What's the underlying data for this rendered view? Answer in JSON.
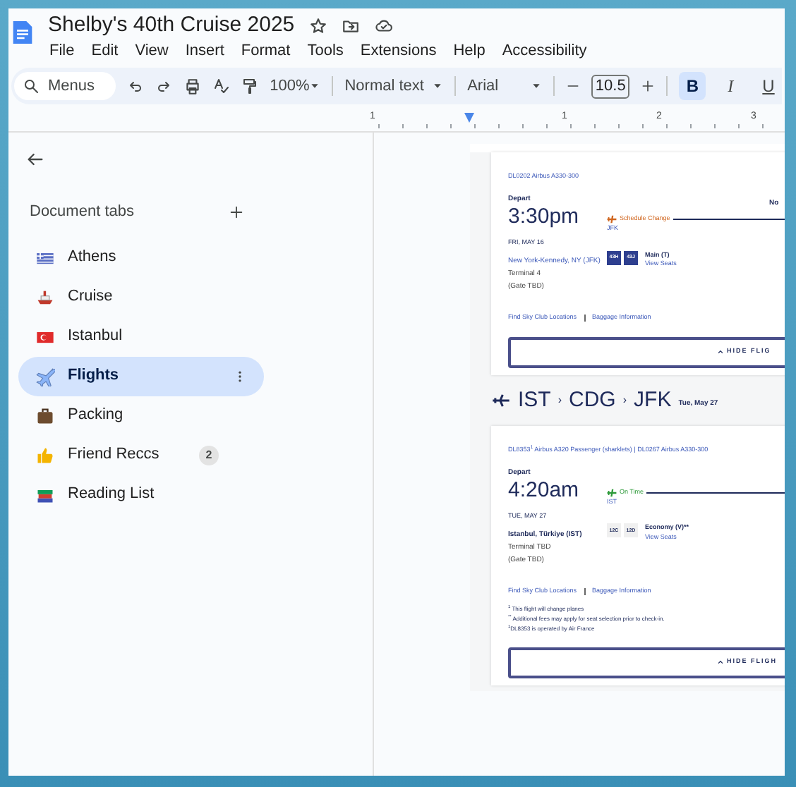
{
  "document": {
    "title": "Shelby's 40th Cruise 2025"
  },
  "menu_bar": [
    "File",
    "Edit",
    "View",
    "Insert",
    "Format",
    "Tools",
    "Extensions",
    "Help",
    "Accessibility"
  ],
  "toolbar": {
    "search_placeholder": "Menus",
    "zoom": "100%",
    "style": "Normal text",
    "font": "Arial",
    "font_size": "10.5",
    "format_buttons": [
      {
        "label": "B",
        "kind": "bold",
        "selected": true
      },
      {
        "label": "I",
        "kind": "italic",
        "selected": false
      },
      {
        "label": "U",
        "kind": "underline",
        "selected": false
      }
    ]
  },
  "ruler": [
    "1",
    "1",
    "2",
    "3"
  ],
  "sidebar": {
    "heading": "Document tabs",
    "tabs": [
      {
        "label": "Athens",
        "kind": "greece-flag",
        "selected": false
      },
      {
        "label": "Cruise",
        "kind": "ship",
        "selected": false
      },
      {
        "label": "Istanbul",
        "kind": "turkey-flag",
        "selected": false
      },
      {
        "label": "Flights",
        "kind": "airplane",
        "selected": true
      },
      {
        "label": "Packing",
        "kind": "luggage",
        "selected": false
      },
      {
        "label": "Friend Reccs",
        "kind": "thumbs-up",
        "selected": false,
        "badge": "2"
      },
      {
        "label": "Reading List",
        "kind": "books",
        "selected": false
      }
    ]
  },
  "page": {
    "flights": [
      {
        "flight_info": "DL0202  Airbus A330-300",
        "depart_label": "Depart",
        "time": "3:30pm",
        "status": "Schedule Change",
        "color": "#d0661f",
        "origin_code": "JFK",
        "right_text": "No",
        "date": "FRI, MAY 16",
        "city": "New York-Kennedy, NY (JFK)",
        "city_bold": false,
        "terminal": "Terminal 4",
        "gate": "(Gate TBD)",
        "seats": [
          {
            "label": "43H",
            "selected": true
          },
          {
            "label": "43J",
            "selected": true
          }
        ],
        "cabin": "Main (T)",
        "seat_link": "View Seats",
        "links": [
          "Find Sky Club Locations",
          "Baggage Information"
        ],
        "button": "HIDE FLIG"
      },
      {
        "route": [
          "IST",
          "CDG",
          "JFK"
        ],
        "route_separator": "›",
        "route_date": "Tue, May 27",
        "flight_info": "DL8353$^{1}$  Airbus A320 Passenger (sharklets)  |  DL0267  Airbus A330-300",
        "depart_label": "Depart",
        "time": "4:20am",
        "status": "On Time",
        "color": "#2e9a3a",
        "origin_code": "IST",
        "date": "TUE, MAY 27",
        "city": "Istanbul, Türkiye (IST)",
        "city_bold": true,
        "terminal": "Terminal TBD",
        "gate": "(Gate TBD)",
        "seats": [
          {
            "label": "12C",
            "selected": false
          },
          {
            "label": "12D",
            "selected": false
          }
        ],
        "cabin": "Economy (V)**",
        "seat_link": "View Seats",
        "links": [
          "Find Sky Club Locations",
          "Baggage Information"
        ],
        "notes": [
          "$^{1}$ This flight will change planes",
          "$^{**}$ Additional fees may apply for seat selection prior to check-in.",
          "$^{1}$DL8353 is operated by Air France"
        ],
        "button": "HIDE FLIGH"
      }
    ]
  }
}
